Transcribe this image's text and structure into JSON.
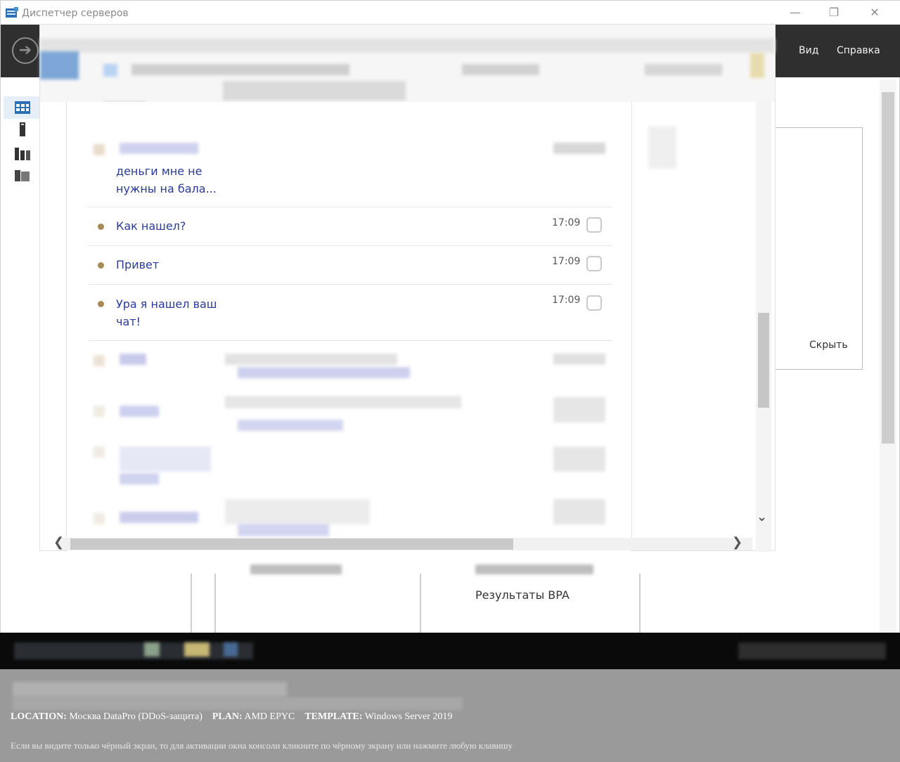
{
  "window": {
    "title": "Диспетчер серверов",
    "minimize": "—",
    "restore": "❐",
    "close": "✕"
  },
  "menu": {
    "view": "Вид",
    "help": "Справка"
  },
  "right_card": {
    "hide_label": "Скрыть"
  },
  "tiles": {
    "bpa_results": "Результаты BPA"
  },
  "chat": {
    "messages": [
      {
        "text": "деньги мне не\nнужны на бала...",
        "time": ""
      },
      {
        "text": "Как нашел?",
        "time": "17:09"
      },
      {
        "text": "Привет",
        "time": "17:09"
      },
      {
        "text": "Ура я нашел ваш\nчат!",
        "time": "17:09"
      }
    ]
  },
  "console": {
    "location_label": "LOCATION:",
    "location_value": "Москва DataPro (DDoS-защита)",
    "plan_label": "PLAN:",
    "plan_value": "AMD EPYC",
    "template_label": "TEMPLATE:",
    "template_value": "Windows Server 2019",
    "hint": "Если вы видите только чёрный экран, то для активации окна консоли кликните по чёрному экрану или нажмите любую клавишу"
  },
  "icons": [
    "server-manager-icon",
    "back-arrow-icon",
    "dashboard-icon",
    "local-server-icon",
    "all-servers-icon",
    "file-services-icon",
    "chevron-down-icon",
    "chevron-left-icon",
    "chevron-right-icon"
  ],
  "colors": {
    "ribbon": "#2f2f2f",
    "message_text": "#2a3a9b",
    "unread_dot": "#a58a55",
    "console_bg": "#9a9a9a"
  }
}
